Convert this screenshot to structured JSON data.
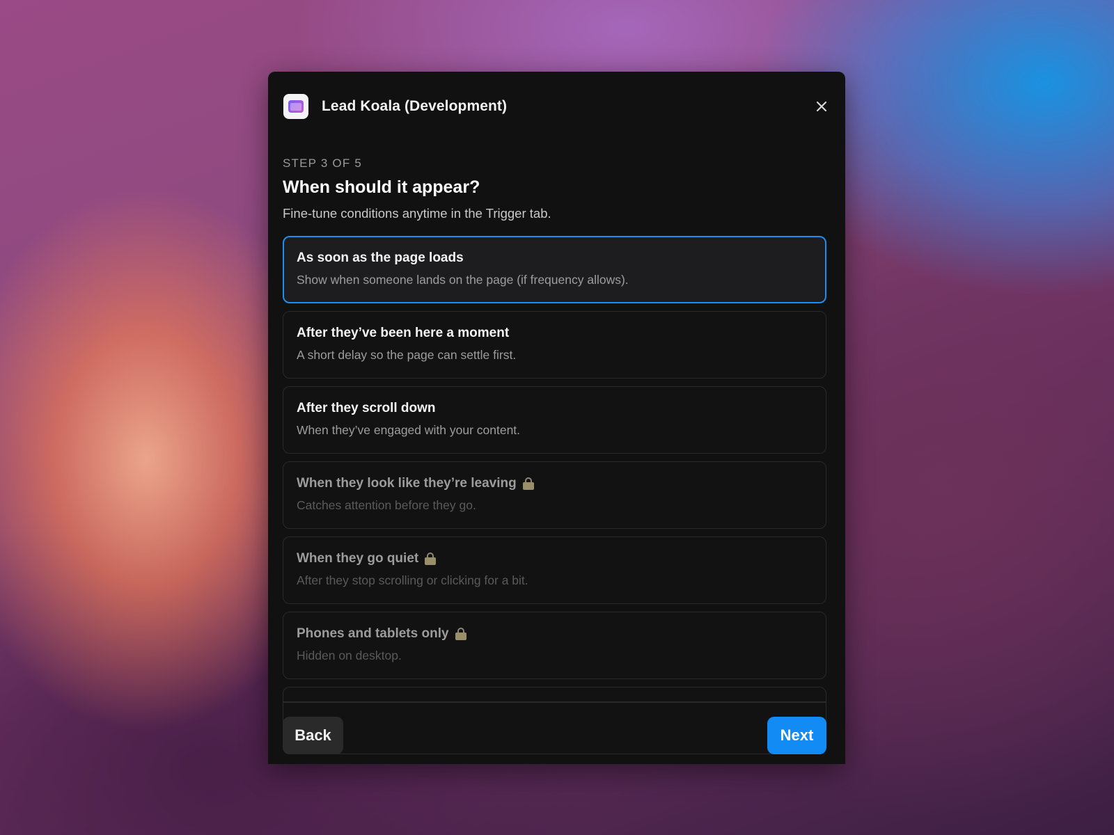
{
  "header": {
    "app_title": "Lead Koala (Development)",
    "app_icon": "app-window-icon",
    "close_icon": "close-icon"
  },
  "step": {
    "label": "STEP 3 OF 5",
    "question": "When should it appear?",
    "subtitle": "Fine-tune conditions anytime in the Trigger tab."
  },
  "options": [
    {
      "title": "As soon as the page loads",
      "description": "Show when someone lands on the page (if frequency allows).",
      "selected": true,
      "locked": false
    },
    {
      "title": "After they’ve been here a moment",
      "description": "A short delay so the page can settle first.",
      "selected": false,
      "locked": false
    },
    {
      "title": "After they scroll down",
      "description": "When they’ve engaged with your content.",
      "selected": false,
      "locked": false
    },
    {
      "title": "When they look like they’re leaving",
      "description": "Catches attention before they go.",
      "selected": false,
      "locked": true
    },
    {
      "title": "When they go quiet",
      "description": "After they stop scrolling or clicking for a bit.",
      "selected": false,
      "locked": true
    },
    {
      "title": "Phones and tablets only",
      "description": "Hidden on desktop.",
      "selected": false,
      "locked": true
    }
  ],
  "footer": {
    "back_label": "Back",
    "next_label": "Next"
  },
  "colors": {
    "accent": "#138bf4",
    "selected_border": "#1e8ff0",
    "dialog_bg": "#111111"
  }
}
